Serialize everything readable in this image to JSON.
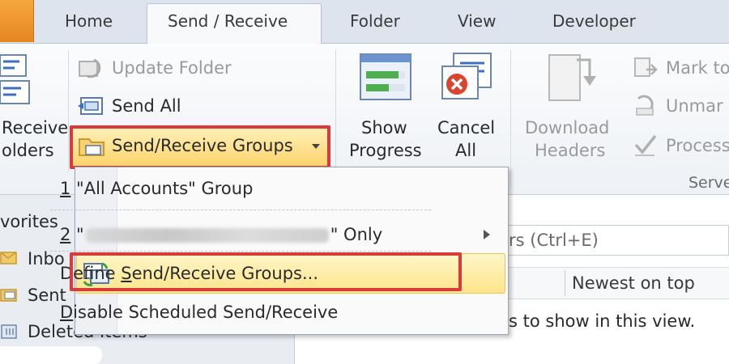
{
  "tabs": {
    "home": "Home",
    "send_receive": "Send / Receive",
    "folder": "Folder",
    "view": "View",
    "developer": "Developer"
  },
  "ribbon": {
    "receive_folders_line1": "Receive",
    "receive_folders_line2": "olders",
    "update_folder": "Update Folder",
    "send_all": "Send All",
    "send_receive_groups": "Send/Receive Groups",
    "show_progress_line1": "Show",
    "show_progress_line2": "Progress",
    "cancel_all_line1": "Cancel",
    "cancel_all_line2": "All",
    "download_headers_line1": "Download",
    "download_headers_line2": "Headers",
    "mark_to": "Mark to",
    "unmark": "Unmar",
    "process": "Process",
    "server_group_label": "Serve",
    "partial_group_label": "S"
  },
  "menu": {
    "item1_num": "1",
    "item1_label": " \"All Accounts\" Group",
    "item2_num": "2",
    "item2_prefix": " \"",
    "item2_suffix": "\" Only",
    "item3_label_pre": "Define ",
    "item3_label_u": "S",
    "item3_label_post": "end/Receive Groups...",
    "item4_label_u": "D",
    "item4_label_post": "isable Scheduled Send/Receive"
  },
  "nav": {
    "favorites": "vorites",
    "inbox": "Inbo",
    "sent": "Sent",
    "deleted": "Deleted Items"
  },
  "mail": {
    "search_placeholder": "rs (Ctrl+E)",
    "sort_order": "Newest on top",
    "empty_message": "s to show in this view."
  },
  "colors": {
    "file_tab": "#f29a2e",
    "highlight": "#fde58a",
    "annotation_red": "#d93a3a"
  }
}
